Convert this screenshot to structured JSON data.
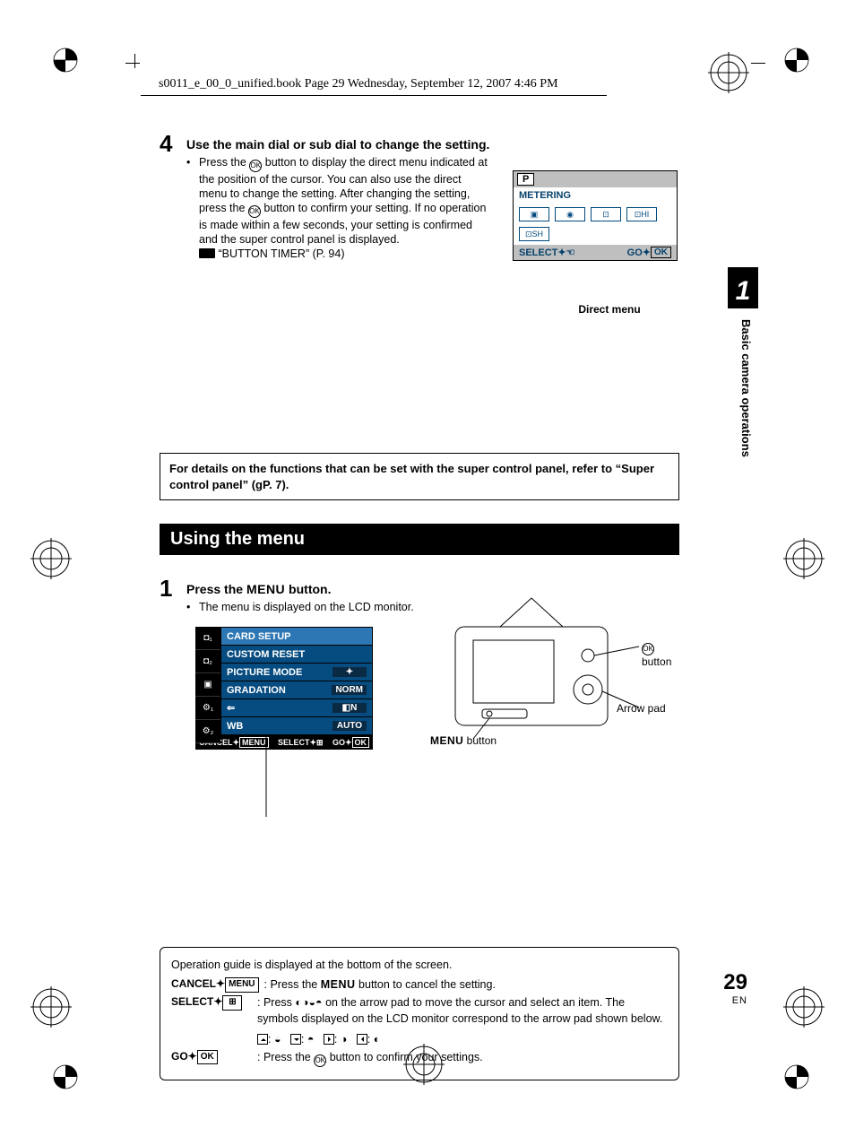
{
  "running_header": "s0011_e_00_0_unified.book  Page 29  Wednesday, September 12, 2007  4:46 PM",
  "step4": {
    "num": "4",
    "heading": "Use the main dial or sub dial to change the setting.",
    "body_before_icon": "Press the ",
    "body_after_icon1": " button to display the direct menu indicated at the position of the cursor. You can also use the direct menu to change the setting. After changing the setting, press the ",
    "body_after_icon2": " button to confirm your setting. If no operation is made within a few seconds, your setting is confirmed and the super control panel is displayed.",
    "ref": "“BUTTON TIMER” (P. 94)"
  },
  "direct_menu": {
    "mode": "P",
    "title": "METERING",
    "cells": [
      "▣",
      "◉",
      "⊡",
      "⊡HI",
      "⊡SH"
    ],
    "select_label": "SELECT",
    "go_label": "GO",
    "ok_button": "OK",
    "caption": "Direct menu"
  },
  "notebox_text": "For details on the functions that can be set with the super control panel, refer to “Super control panel” (gP. 7).",
  "section_title": "Using the menu",
  "step1": {
    "num": "1",
    "heading_before": "Press the ",
    "menu_word": "MENU",
    "heading_after": " button.",
    "bullet": "The menu is displayed on the LCD monitor."
  },
  "menu_shot": {
    "tabs": [
      "◘₁",
      "◘₂",
      "▣",
      "⚙₁",
      "⚙₂"
    ],
    "rows": [
      {
        "label": "CARD SETUP",
        "val": ""
      },
      {
        "label": "CUSTOM RESET",
        "val": ""
      },
      {
        "label": "PICTURE MODE",
        "val": "✦"
      },
      {
        "label": "GRADATION",
        "val": "NORM"
      },
      {
        "label": "⇐",
        "val": "◧N"
      },
      {
        "label": "WB",
        "val": "AUTO"
      }
    ],
    "foot_cancel": "CANCEL",
    "foot_cancel_key": "MENU",
    "foot_select": "SELECT",
    "foot_go": "GO",
    "foot_ok": "OK"
  },
  "camera_labels": {
    "ok_button": " button",
    "arrow_pad": "Arrow pad",
    "menu_button_before": "",
    "menu_button_word": "MENU",
    "menu_button_after": " button"
  },
  "opbox": {
    "lead": "Operation guide is displayed at the bottom of the screen.",
    "cancel_key": "CANCEL",
    "cancel_btn": "MENU",
    "cancel_text_before": ": Press the ",
    "cancel_text_menu": "MENU",
    "cancel_text_after": " button to cancel the setting.",
    "select_key": "SELECT",
    "select_text1": ": Press ",
    "select_text2": " on the arrow pad to move the cursor and select an item. The symbols displayed on the LCD monitor correspond to the arrow pad shown below.",
    "go_key": "GO",
    "go_ok": "OK",
    "go_text_before": ": Press the ",
    "go_text_after": " button to confirm your settings."
  },
  "side_tab": {
    "chapter_num": "1",
    "chapter_text": "Basic camera operations"
  },
  "footer": {
    "page": "29",
    "lang": "EN"
  },
  "chart_data": null
}
